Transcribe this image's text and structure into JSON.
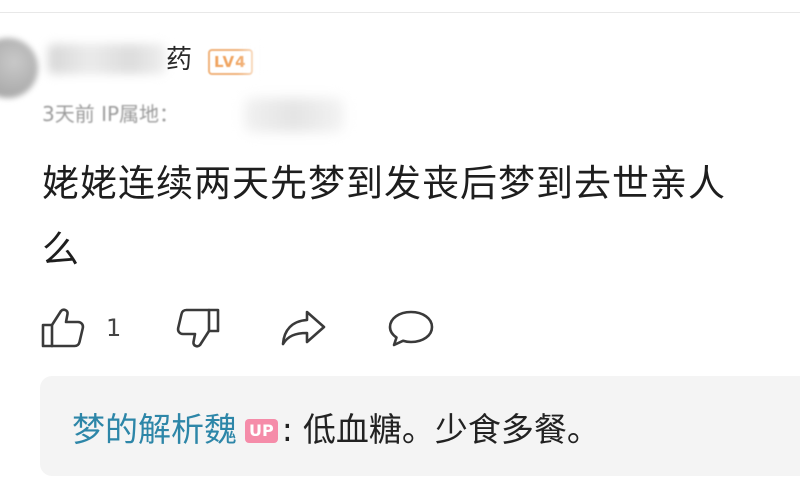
{
  "comment": {
    "username": "药",
    "level_badge": "LV4",
    "meta": "3天前 IP属地：",
    "text_line1": "姥姥连续两天先梦到发丧后梦到去世亲人",
    "text_line2": "么"
  },
  "actions": {
    "like_count": "1"
  },
  "reply": {
    "author": "梦的解析魏",
    "badge": "UP",
    "separator": ":",
    "text": "低血糖。少食多餐。"
  },
  "colors": {
    "author_link": "#2d86a8",
    "up_badge": "#f58ca9",
    "level_badge": "#f0a460"
  }
}
